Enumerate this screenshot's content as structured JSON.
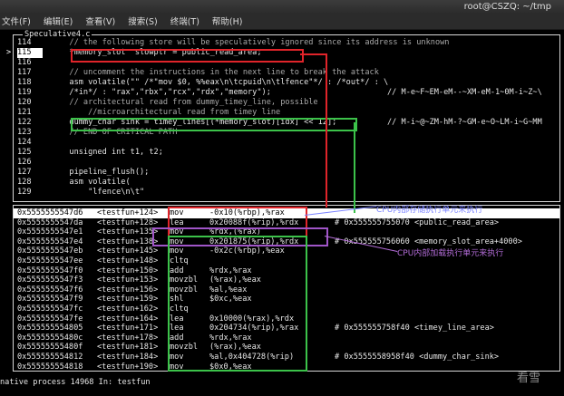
{
  "window": {
    "title": "root@CSZQ: ~/tmp"
  },
  "menu": [
    "文件(F)",
    "编辑(E)",
    "查看(V)",
    "搜索(S)",
    "终端(T)",
    "帮助(H)"
  ],
  "source_window": {
    "title": "Speculative4.c",
    "current_marker": ">",
    "lines": [
      {
        "n": "114",
        "code": "        // the following store will be speculatively ignored since its address is unknown",
        "right": ""
      },
      {
        "n": "115",
        "code": "        *memory_slot  slowptr = public_read_area;",
        "right": ""
      },
      {
        "n": "116",
        "code": "",
        "right": ""
      },
      {
        "n": "117",
        "code": "        // uncomment the instructions in the next line to break the attack",
        "right": ""
      },
      {
        "n": "118",
        "code": "        asm volatile(\"\" /*\"mov $0, %%eax\\n\\tcpuid\\n\\tlfence\"*/ : /*out*/ : \\",
        "right": ""
      },
      {
        "n": "119",
        "code": "        /*in*/ : \"rax\",\"rbx\",\"rcx\",\"rdx\",\"memory\");",
        "right": "// M-e~F~EM-eM--~XM-eM-1~0M-i~Z~\\"
      },
      {
        "n": "120",
        "code": "        // architectural read from dummy_timey_line, possible",
        "right": ""
      },
      {
        "n": "121",
        "code": "            //microarchitectural read from timey line",
        "right": ""
      },
      {
        "n": "122",
        "code": "        dummy_char sink = timey_lines[(*memory_slot)[idx] << 12];",
        "right": "// M-i~@~ZM-hM-?~GM-e~O~LM-i~G~MM"
      },
      {
        "n": "123",
        "code": "        // END OF CRITICAL PATH",
        "right": ""
      },
      {
        "n": "124",
        "code": "",
        "right": ""
      },
      {
        "n": "125",
        "code": "        unsigned int t1, t2;",
        "right": ""
      },
      {
        "n": "126",
        "code": "",
        "right": ""
      },
      {
        "n": "127",
        "code": "        pipeline_flush();",
        "right": ""
      },
      {
        "n": "128",
        "code": "        asm volatile(",
        "right": ""
      },
      {
        "n": "129",
        "code": "            \"lfence\\n\\t\"",
        "right": ""
      }
    ]
  },
  "asm_window": {
    "rows": [
      {
        "addr": "0x5555555547d6",
        "fn": "<testfun+124>",
        "mn": "mov",
        "op": "-0x10(%rbp),%rax",
        "cm": ""
      },
      {
        "addr": "0x5555555547da",
        "fn": "<testfun+128>",
        "mn": "lea",
        "op": "0x20088f(%rip),%rdx",
        "cm": "# 0x555555755070 <public_read_area>"
      },
      {
        "addr": "0x5555555547e1",
        "fn": "<testfun+135>",
        "mn": "mov",
        "op": "%rdx,(%rax)",
        "cm": ""
      },
      {
        "addr": "0x5555555547e4",
        "fn": "<testfun+138>",
        "mn": "mov",
        "op": "0x201875(%rip),%rdx",
        "cm": "# 0x555555756060 <memory_slot_area+4000>"
      },
      {
        "addr": "0x5555555547eb",
        "fn": "<testfun+145>",
        "mn": "mov",
        "op": "-0x2c(%rbp),%eax",
        "cm": ""
      },
      {
        "addr": "0x5555555547ee",
        "fn": "<testfun+148>",
        "mn": "cltq",
        "op": "",
        "cm": ""
      },
      {
        "addr": "0x5555555547f0",
        "fn": "<testfun+150>",
        "mn": "add",
        "op": "%rdx,%rax",
        "cm": ""
      },
      {
        "addr": "0x5555555547f3",
        "fn": "<testfun+153>",
        "mn": "movzbl",
        "op": "(%rax),%eax",
        "cm": ""
      },
      {
        "addr": "0x5555555547f6",
        "fn": "<testfun+156>",
        "mn": "movzbl",
        "op": "%al,%eax",
        "cm": ""
      },
      {
        "addr": "0x5555555547f9",
        "fn": "<testfun+159>",
        "mn": "shl",
        "op": "$0xc,%eax",
        "cm": ""
      },
      {
        "addr": "0x5555555547fc",
        "fn": "<testfun+162>",
        "mn": "cltq",
        "op": "",
        "cm": ""
      },
      {
        "addr": "0x5555555547fe",
        "fn": "<testfun+164>",
        "mn": "lea",
        "op": "0x10000(%rax),%rdx",
        "cm": ""
      },
      {
        "addr": "0x555555554805",
        "fn": "<testfun+171>",
        "mn": "lea",
        "op": "0x204734(%rip),%rax",
        "cm": "# 0x555555758f40 <timey_line_area>"
      },
      {
        "addr": "0x55555555480c",
        "fn": "<testfun+178>",
        "mn": "add",
        "op": "%rdx,%rax",
        "cm": ""
      },
      {
        "addr": "0x55555555480f",
        "fn": "<testfun+181>",
        "mn": "movzbl",
        "op": "(%rax),%eax",
        "cm": ""
      },
      {
        "addr": "0x555555554812",
        "fn": "<testfun+184>",
        "mn": "mov",
        "op": "%al,0x404728(%rip)",
        "cm": "# 0x5555558958f40 <dummy_char_sink>"
      },
      {
        "addr": "0x555555554818",
        "fn": "<testfun+190>",
        "mn": "mov",
        "op": "$0x0,%eax",
        "cm": ""
      }
    ]
  },
  "annotations": {
    "store": "CPU内部存储执行单元来执行",
    "load": "CPU内部加载执行单元来执行"
  },
  "status": "native process 14968 In: testfun",
  "watermark": "看雪",
  "colors": {
    "red": "#e0242a",
    "green": "#3cc24a",
    "purple": "#a055c8",
    "blue_text": "#7b83ff"
  }
}
